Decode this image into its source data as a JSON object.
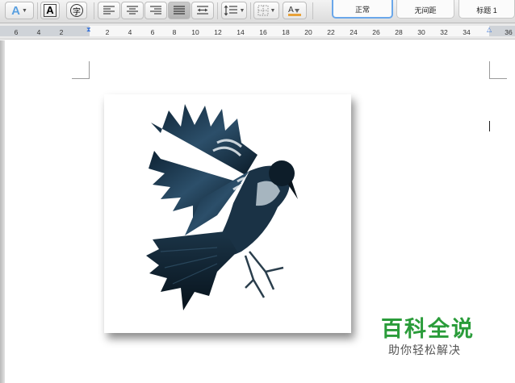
{
  "toolbar": {
    "text_effects_icon": "text-effects-icon",
    "char_shading_icon": "character-shading-icon",
    "enclose_char_icon": "enclose-character-icon",
    "enclose_char_glyph": "字",
    "align_left_icon": "align-left-icon",
    "align_center_icon": "align-center-icon",
    "align_right_icon": "align-right-icon",
    "justify_icon": "justify-icon",
    "distributed_icon": "distribute-icon",
    "line_spacing_icon": "line-spacing-icon",
    "borders_icon": "borders-icon",
    "shading_icon": "shading-icon"
  },
  "styles": [
    {
      "label": "正常",
      "selected": true
    },
    {
      "label": "无间距",
      "selected": false
    },
    {
      "label": "标题 1",
      "selected": false
    }
  ],
  "ruler": {
    "ticks": [
      "6",
      "4",
      "2",
      "2",
      "4",
      "6",
      "8",
      "10",
      "12",
      "14",
      "16",
      "18",
      "20",
      "22",
      "24",
      "26",
      "28",
      "30",
      "32",
      "34",
      "36"
    ]
  },
  "document": {
    "image_subject": "bird-illustration"
  },
  "watermark": {
    "title": "百科全说",
    "subtitle": "助你轻松解决",
    "brand_color": "#2a9c3a"
  }
}
